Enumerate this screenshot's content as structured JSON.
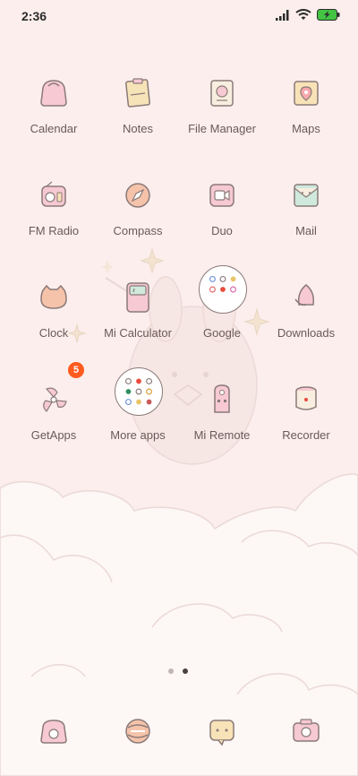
{
  "status_bar": {
    "time": "2:36",
    "icons": [
      "signal-icon",
      "wifi-icon",
      "battery-charging-icon"
    ],
    "battery_color": "#43c543"
  },
  "apps": [
    {
      "label": "Calendar",
      "icon": "calendar-icon"
    },
    {
      "label": "Notes",
      "icon": "notes-icon"
    },
    {
      "label": "File Manager",
      "icon": "file-manager-icon"
    },
    {
      "label": "Maps",
      "icon": "maps-icon"
    },
    {
      "label": "FM Radio",
      "icon": "radio-icon"
    },
    {
      "label": "Compass",
      "icon": "compass-icon"
    },
    {
      "label": "Duo",
      "icon": "video-camera-icon"
    },
    {
      "label": "Mail",
      "icon": "mail-icon"
    },
    {
      "label": "Clock",
      "icon": "clock-icon"
    },
    {
      "label": "Mi Calculator",
      "icon": "calculator-icon"
    },
    {
      "label": "Google",
      "icon": "folder-icon"
    },
    {
      "label": "Downloads",
      "icon": "downloads-icon"
    },
    {
      "label": "GetApps",
      "icon": "getapps-icon",
      "badge": "5"
    },
    {
      "label": "More apps",
      "icon": "folder-icon"
    },
    {
      "label": "Mi Remote",
      "icon": "remote-icon"
    },
    {
      "label": "Recorder",
      "icon": "recorder-icon"
    }
  ],
  "page_indicator": {
    "pages": 2,
    "current": 2
  },
  "dock": [
    {
      "icon": "phone-icon"
    },
    {
      "icon": "browser-icon"
    },
    {
      "icon": "messages-icon"
    },
    {
      "icon": "camera-icon"
    }
  ],
  "theme": {
    "background": "#fbeeec",
    "icon_outline": "#8a7a78"
  }
}
